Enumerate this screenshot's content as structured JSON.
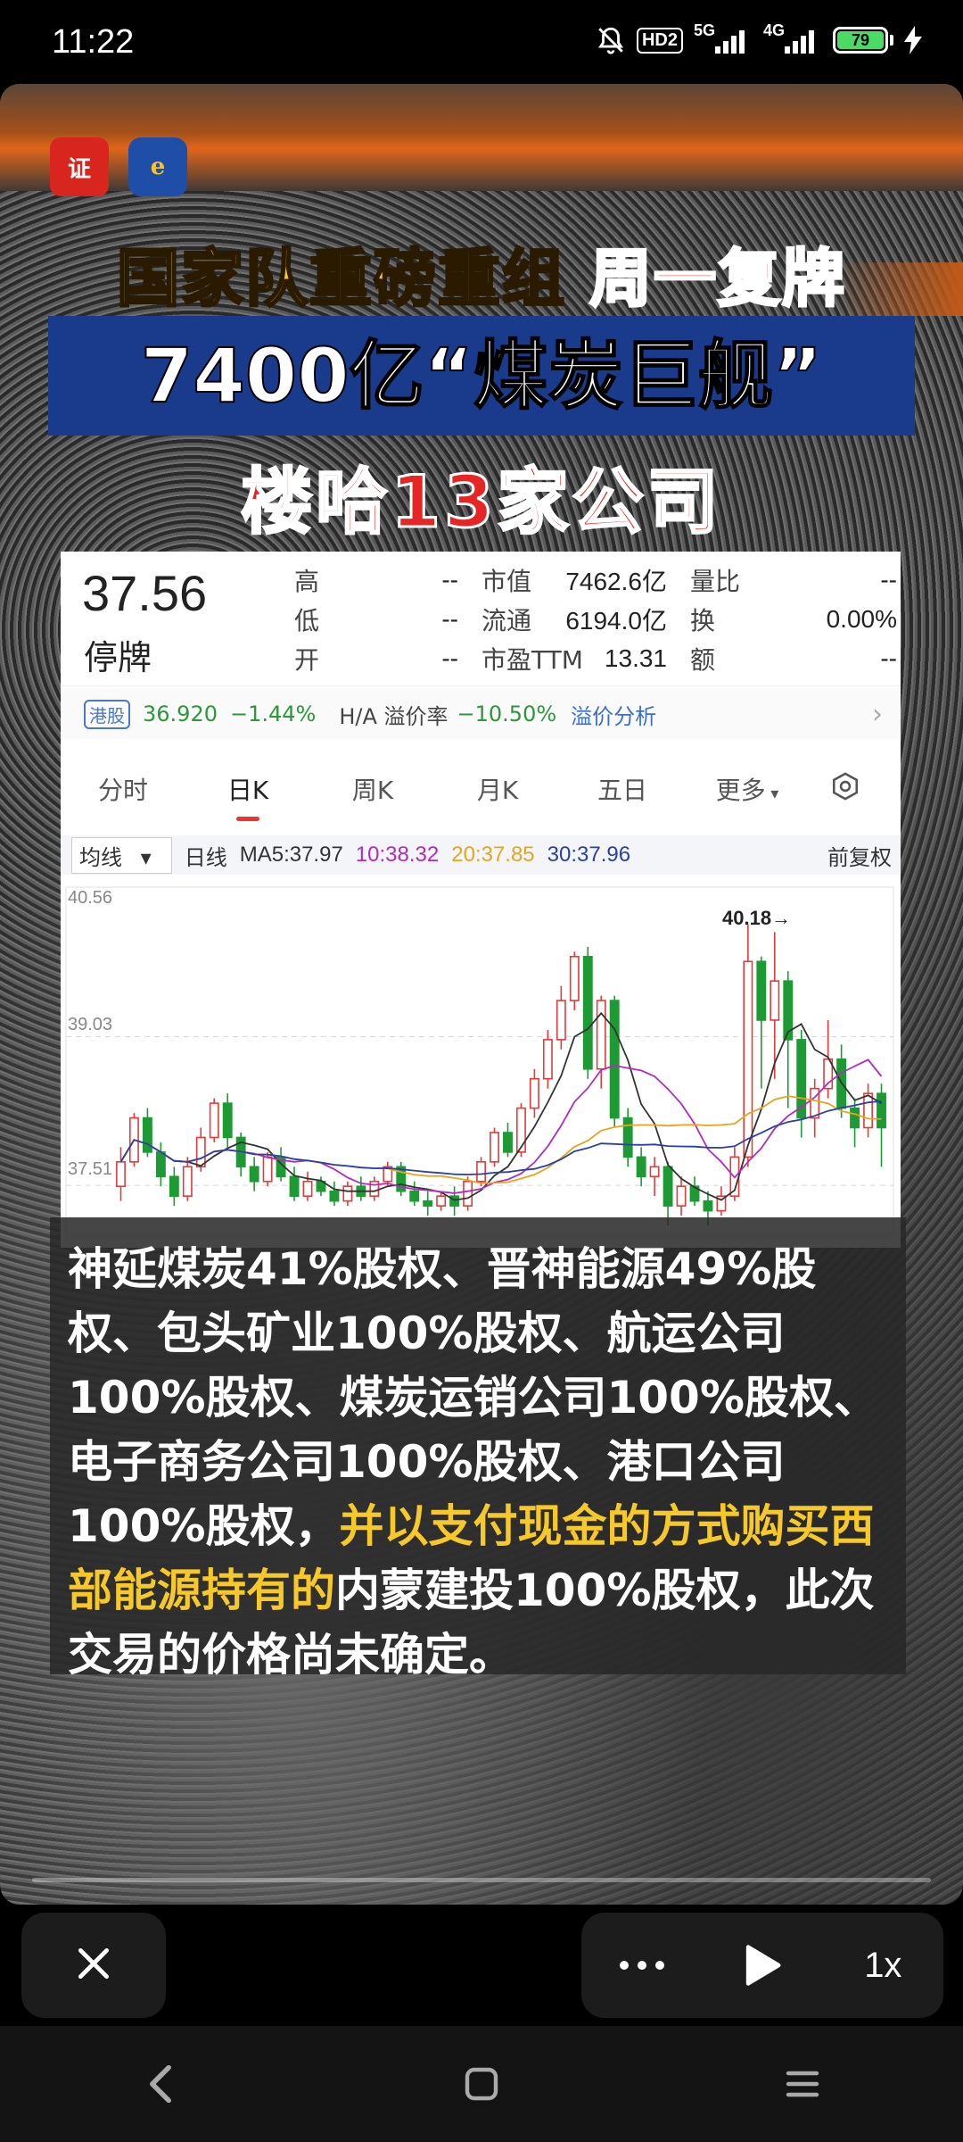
{
  "status_bar": {
    "time": "11:22",
    "hd_label": "HD2",
    "net1": "5G",
    "net2": "4G",
    "battery": "79"
  },
  "video": {
    "logo1_text": "证券时报",
    "logo2_text": "e公司",
    "headline_line1_a": "国家队重磅重组",
    "headline_line1_b": "周一复牌",
    "headline_line2": "7400亿“煤炭巨舰”",
    "headline_line3": "楼哈13家公司",
    "progress_fraction": 0.0
  },
  "stock": {
    "price": "37.56",
    "status": "停牌",
    "metrics": [
      [
        {
          "label": "高",
          "value": "--"
        },
        {
          "label": "市值",
          "value": "7462.6亿"
        },
        {
          "label": "量比",
          "value": "--"
        }
      ],
      [
        {
          "label": "低",
          "value": "--"
        },
        {
          "label": "流通",
          "value": "6194.0亿"
        },
        {
          "label": "换",
          "value": "0.00%"
        }
      ],
      [
        {
          "label": "开",
          "value": "--"
        },
        {
          "label": "市盈TTM",
          "value": "13.31"
        },
        {
          "label": "额",
          "value": "--"
        }
      ]
    ],
    "hk_tag": "港股",
    "hk_price": "36.920",
    "hk_change": "−1.44%",
    "premium_label": "H/A 溢价率",
    "premium_value": "−10.50%",
    "premium_link": "溢价分析",
    "tabs": [
      "分时",
      "日K",
      "周K",
      "月K",
      "五日",
      "更多"
    ],
    "active_tab": "日K",
    "ma_dropdown": "均线",
    "ma_period": "日线",
    "ma5": "MA5:37.97",
    "ma10": "10:38.32",
    "ma20": "20:37.85",
    "ma30": "30:37.96",
    "adjust": "前复权"
  },
  "chart_data": {
    "type": "candlestick",
    "y_ticks": [
      "40.56",
      "39.03",
      "37.51"
    ],
    "ylim": [
      37.0,
      40.56
    ],
    "high_marker": "40.18→",
    "colors": {
      "up": "#e33a3a",
      "down": "#1e9a34",
      "ma5": "#333333",
      "ma10": "#b02cc0",
      "ma20": "#e8a51c",
      "ma30": "#2a3fa8"
    },
    "candles": [
      [
        37.5,
        37.75,
        37.35,
        37.9
      ],
      [
        37.75,
        38.2,
        37.7,
        38.25
      ],
      [
        38.2,
        37.85,
        37.8,
        38.3
      ],
      [
        37.85,
        37.6,
        37.5,
        37.95
      ],
      [
        37.6,
        37.4,
        37.3,
        37.7
      ],
      [
        37.4,
        37.7,
        37.35,
        37.8
      ],
      [
        37.7,
        38.0,
        37.65,
        38.1
      ],
      [
        38.0,
        38.35,
        37.95,
        38.4
      ],
      [
        38.35,
        38.0,
        37.9,
        38.45
      ],
      [
        38.0,
        37.7,
        37.6,
        38.05
      ],
      [
        37.7,
        37.55,
        37.45,
        37.8
      ],
      [
        37.55,
        37.8,
        37.5,
        37.85
      ],
      [
        37.8,
        37.6,
        37.55,
        37.9
      ],
      [
        37.6,
        37.4,
        37.35,
        37.7
      ],
      [
        37.4,
        37.55,
        37.35,
        37.65
      ],
      [
        37.55,
        37.45,
        37.4,
        37.6
      ],
      [
        37.45,
        37.35,
        37.3,
        37.55
      ],
      [
        37.35,
        37.5,
        37.3,
        37.55
      ],
      [
        37.5,
        37.4,
        37.35,
        37.6
      ],
      [
        37.4,
        37.55,
        37.35,
        37.6
      ],
      [
        37.55,
        37.7,
        37.5,
        37.75
      ],
      [
        37.7,
        37.45,
        37.4,
        37.75
      ],
      [
        37.45,
        37.35,
        37.3,
        37.55
      ],
      [
        37.35,
        37.3,
        37.2,
        37.45
      ],
      [
        37.3,
        37.4,
        37.25,
        37.45
      ],
      [
        37.4,
        37.3,
        37.2,
        37.5
      ],
      [
        37.3,
        37.55,
        37.25,
        37.6
      ],
      [
        37.55,
        37.75,
        37.5,
        37.8
      ],
      [
        37.75,
        38.05,
        37.7,
        38.1
      ],
      [
        38.05,
        37.85,
        37.8,
        38.15
      ],
      [
        37.85,
        38.3,
        37.8,
        38.35
      ],
      [
        38.3,
        38.6,
        38.2,
        38.7
      ],
      [
        38.6,
        39.0,
        38.5,
        39.1
      ],
      [
        39.0,
        39.4,
        38.9,
        39.55
      ],
      [
        39.4,
        39.85,
        39.3,
        39.9
      ],
      [
        39.85,
        38.7,
        38.6,
        39.95
      ],
      [
        38.7,
        39.4,
        38.5,
        39.45
      ],
      [
        39.4,
        38.2,
        38.1,
        39.45
      ],
      [
        38.2,
        37.8,
        37.7,
        38.3
      ],
      [
        37.8,
        37.6,
        37.5,
        37.9
      ],
      [
        37.6,
        37.7,
        37.4,
        37.8
      ],
      [
        37.7,
        37.3,
        37.1,
        37.75
      ],
      [
        37.3,
        37.5,
        37.2,
        37.6
      ],
      [
        37.5,
        37.35,
        37.3,
        37.6
      ],
      [
        37.35,
        37.25,
        37.1,
        37.45
      ],
      [
        37.25,
        37.4,
        37.2,
        37.5
      ],
      [
        37.4,
        37.8,
        37.35,
        37.9
      ],
      [
        37.8,
        39.8,
        37.7,
        40.18
      ],
      [
        39.8,
        39.2,
        38.5,
        39.85
      ],
      [
        39.2,
        39.6,
        38.6,
        40.1
      ],
      [
        39.6,
        39.0,
        38.3,
        39.7
      ],
      [
        39.0,
        38.2,
        38.0,
        39.1
      ],
      [
        38.2,
        38.5,
        38.0,
        38.6
      ],
      [
        38.5,
        38.8,
        38.4,
        39.2
      ],
      [
        38.8,
        38.3,
        38.2,
        38.95
      ],
      [
        38.3,
        38.1,
        37.9,
        38.4
      ],
      [
        38.1,
        38.45,
        38.0,
        38.55
      ],
      [
        38.45,
        38.1,
        37.7,
        38.55
      ]
    ]
  },
  "caption": {
    "text_a": "神延煤炭41%股权、晋神能源49%股权、包头矿业100%股权、航运公司100%股权、煤炭运销公司100%股权、电子商务公司100%股权、港口公司100%股权，",
    "text_b": "并以支付现金的方式购买西部能源持有的",
    "text_c": "内蒙建投100%股权，此次交易的价格尚未确定。"
  },
  "controls": {
    "speed": "1x"
  }
}
